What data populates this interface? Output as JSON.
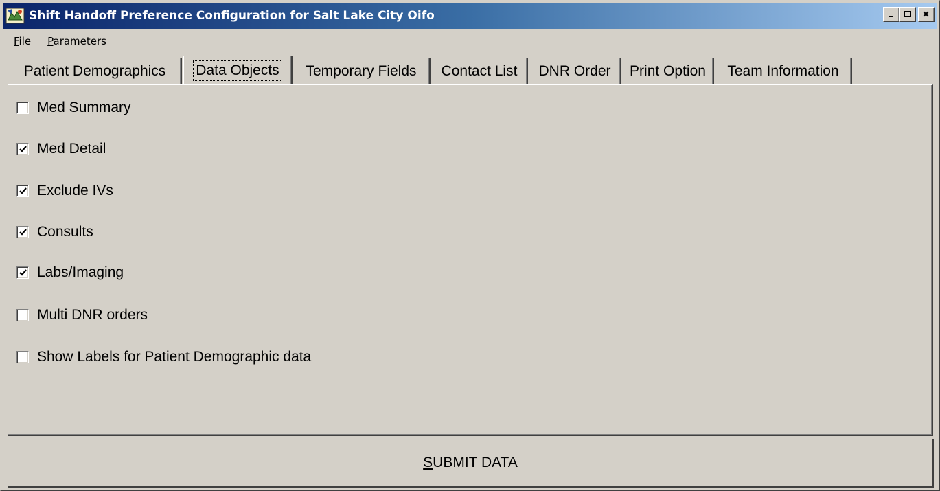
{
  "window": {
    "title": "Shift Handoff Preference Configuration for Salt Lake City Oifo"
  },
  "menu": {
    "file_first": "F",
    "file_rest": "ile",
    "params_first": "P",
    "params_rest": "arameters"
  },
  "tabs": [
    {
      "label": "Patient Demographics",
      "selected": false
    },
    {
      "label": "Data Objects",
      "selected": true
    },
    {
      "label": "Temporary Fields",
      "selected": false
    },
    {
      "label": "Contact List",
      "selected": false
    },
    {
      "label": "DNR Order",
      "selected": false
    },
    {
      "label": "Print Option",
      "selected": false
    },
    {
      "label": "Team Information",
      "selected": false
    }
  ],
  "options": [
    {
      "label": "Med Summary",
      "checked": false
    },
    {
      "label": "Med Detail",
      "checked": true
    },
    {
      "label": "Exclude IVs",
      "checked": true
    },
    {
      "label": "Consults",
      "checked": true
    },
    {
      "label": "Labs/Imaging",
      "checked": true
    },
    {
      "label": "Multi DNR orders",
      "checked": false
    },
    {
      "label": "Show Labels for Patient Demographic data",
      "checked": false
    }
  ],
  "submit": {
    "first": "S",
    "rest": "UBMIT DATA"
  }
}
